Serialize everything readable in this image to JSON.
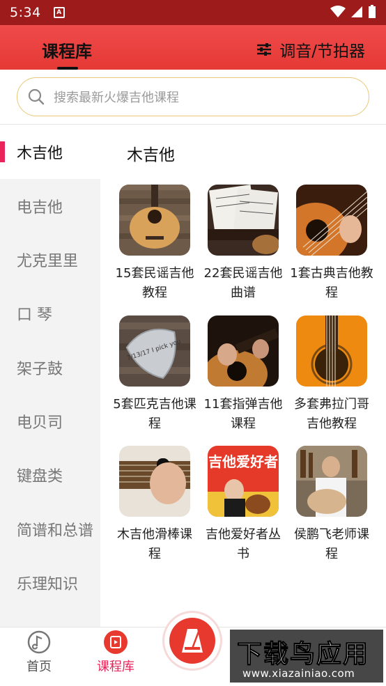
{
  "status_bar": {
    "time": "5:34",
    "sim_icon": "A"
  },
  "header": {
    "title": "课程库",
    "tuner_label": "调音/节拍器",
    "tuner_icon": "sliders-icon"
  },
  "search": {
    "placeholder": "搜索最新火爆吉他课程",
    "icon": "search-icon"
  },
  "sidebar": {
    "items": [
      {
        "label": "木吉他",
        "active": true
      },
      {
        "label": "电吉他"
      },
      {
        "label": "尤克里里"
      },
      {
        "label": "口 琴"
      },
      {
        "label": "架子鼓"
      },
      {
        "label": "电贝司"
      },
      {
        "label": "键盘类"
      },
      {
        "label": "简谱和总谱"
      },
      {
        "label": "乐理知识"
      }
    ]
  },
  "content": {
    "category_title": "木吉他",
    "tiles": [
      {
        "label": "15套民谣吉他教程"
      },
      {
        "label": "22套民谣吉他曲谱"
      },
      {
        "label": "1套古典吉他教程"
      },
      {
        "label": "5套匹克吉他课程"
      },
      {
        "label": "11套指弹吉他课程"
      },
      {
        "label": "多套弗拉门哥吉他教程"
      },
      {
        "label": "木吉他滑棒课程"
      },
      {
        "label": "吉他爱好者丛书"
      },
      {
        "label": "侯鹏飞老师课程"
      }
    ],
    "pick_text": "7/13/17 I pick you",
    "book_cover_text": "吉他爱好者"
  },
  "bottom_nav": {
    "items": [
      {
        "label": "首页",
        "icon": "note-icon"
      },
      {
        "label": "课程库",
        "icon": "play-icon",
        "active": true
      },
      {
        "label": "",
        "icon": "metronome-icon"
      }
    ]
  },
  "watermark": {
    "text": "下载鸟应用",
    "url": "www.xiazainiao.com"
  },
  "colors": {
    "accent": "#e53935",
    "active_red": "#e8245a",
    "search_border": "#e9c878"
  }
}
